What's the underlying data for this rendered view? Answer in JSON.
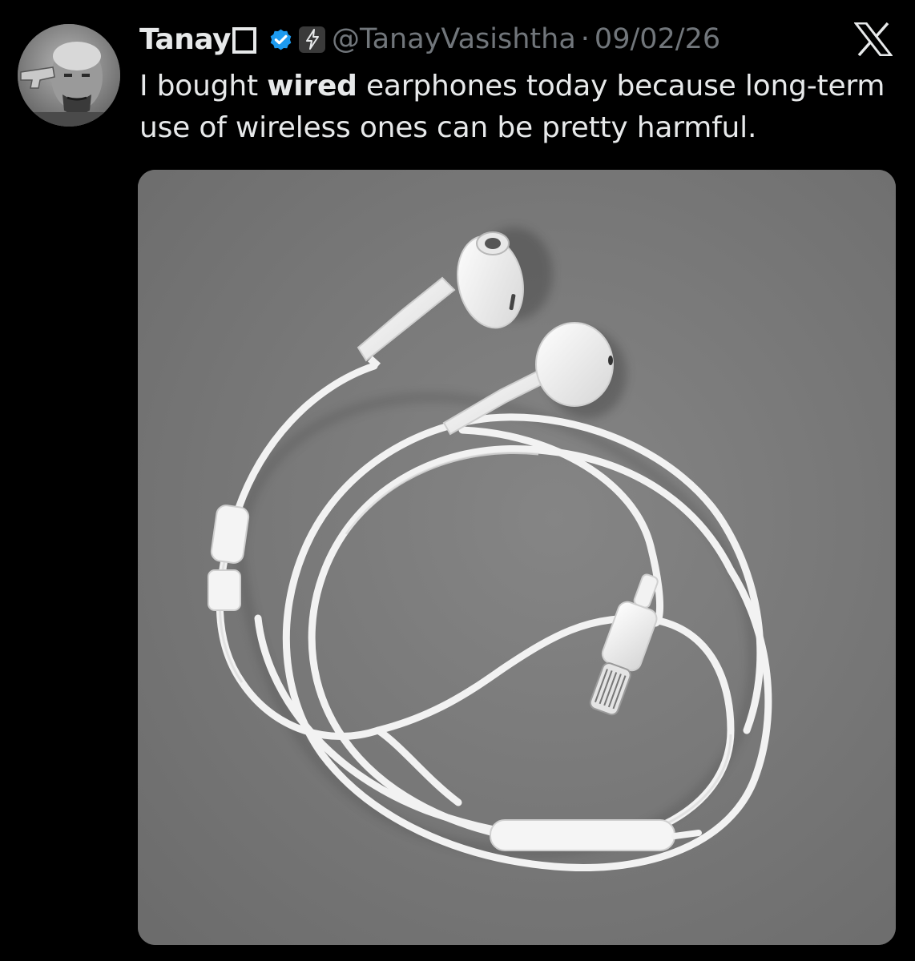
{
  "author": {
    "display_name": "Tanay",
    "handle": "@TanayVasishtha",
    "separator": "·",
    "date": "09/02/26",
    "verified_badge_icon": "verified-check-icon",
    "subscription_badge_icon": "lightning-bolt-icon"
  },
  "tweet": {
    "text_before": "I bought ",
    "text_bold": "wired",
    "text_after": " earphones today because long-term use of wireless ones can be pretty harmful."
  },
  "media": {
    "subject": "white wired earphones with lightning connector on grey surface"
  },
  "colors": {
    "background": "#000000",
    "text_primary": "#e7e9ea",
    "text_secondary": "#71767b",
    "verified_blue": "#1d9bf0",
    "photo_bg": "#7a7a7a"
  },
  "icons": [
    "x-logo-icon",
    "verified-check-icon",
    "lightning-bolt-icon"
  ]
}
